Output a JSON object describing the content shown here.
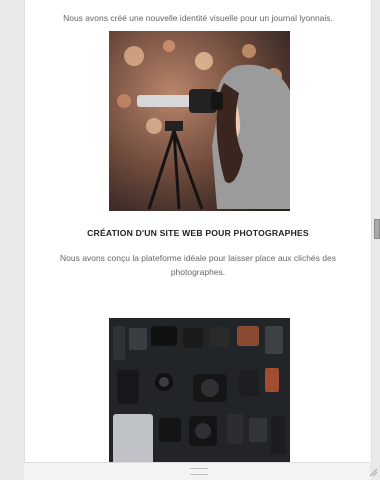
{
  "project1": {
    "description": "Nous avons créé une nouvelle identité visuelle pour un journal lyonnais."
  },
  "project2": {
    "title": "CRÉATION D'UN SITE WEB POUR PHOTOGRAPHES",
    "description": "Nous avons conçu la plateforme idéale pour laisser place aux clichés des photographes."
  },
  "colors": {
    "panel_bg": "#ffffff",
    "page_bg": "#e9e9e9",
    "title_text": "#222222",
    "body_text": "#666666"
  },
  "icons": {
    "resize_handle": "resize-grip-icon",
    "drawer_handle": "drag-handle-icon"
  }
}
